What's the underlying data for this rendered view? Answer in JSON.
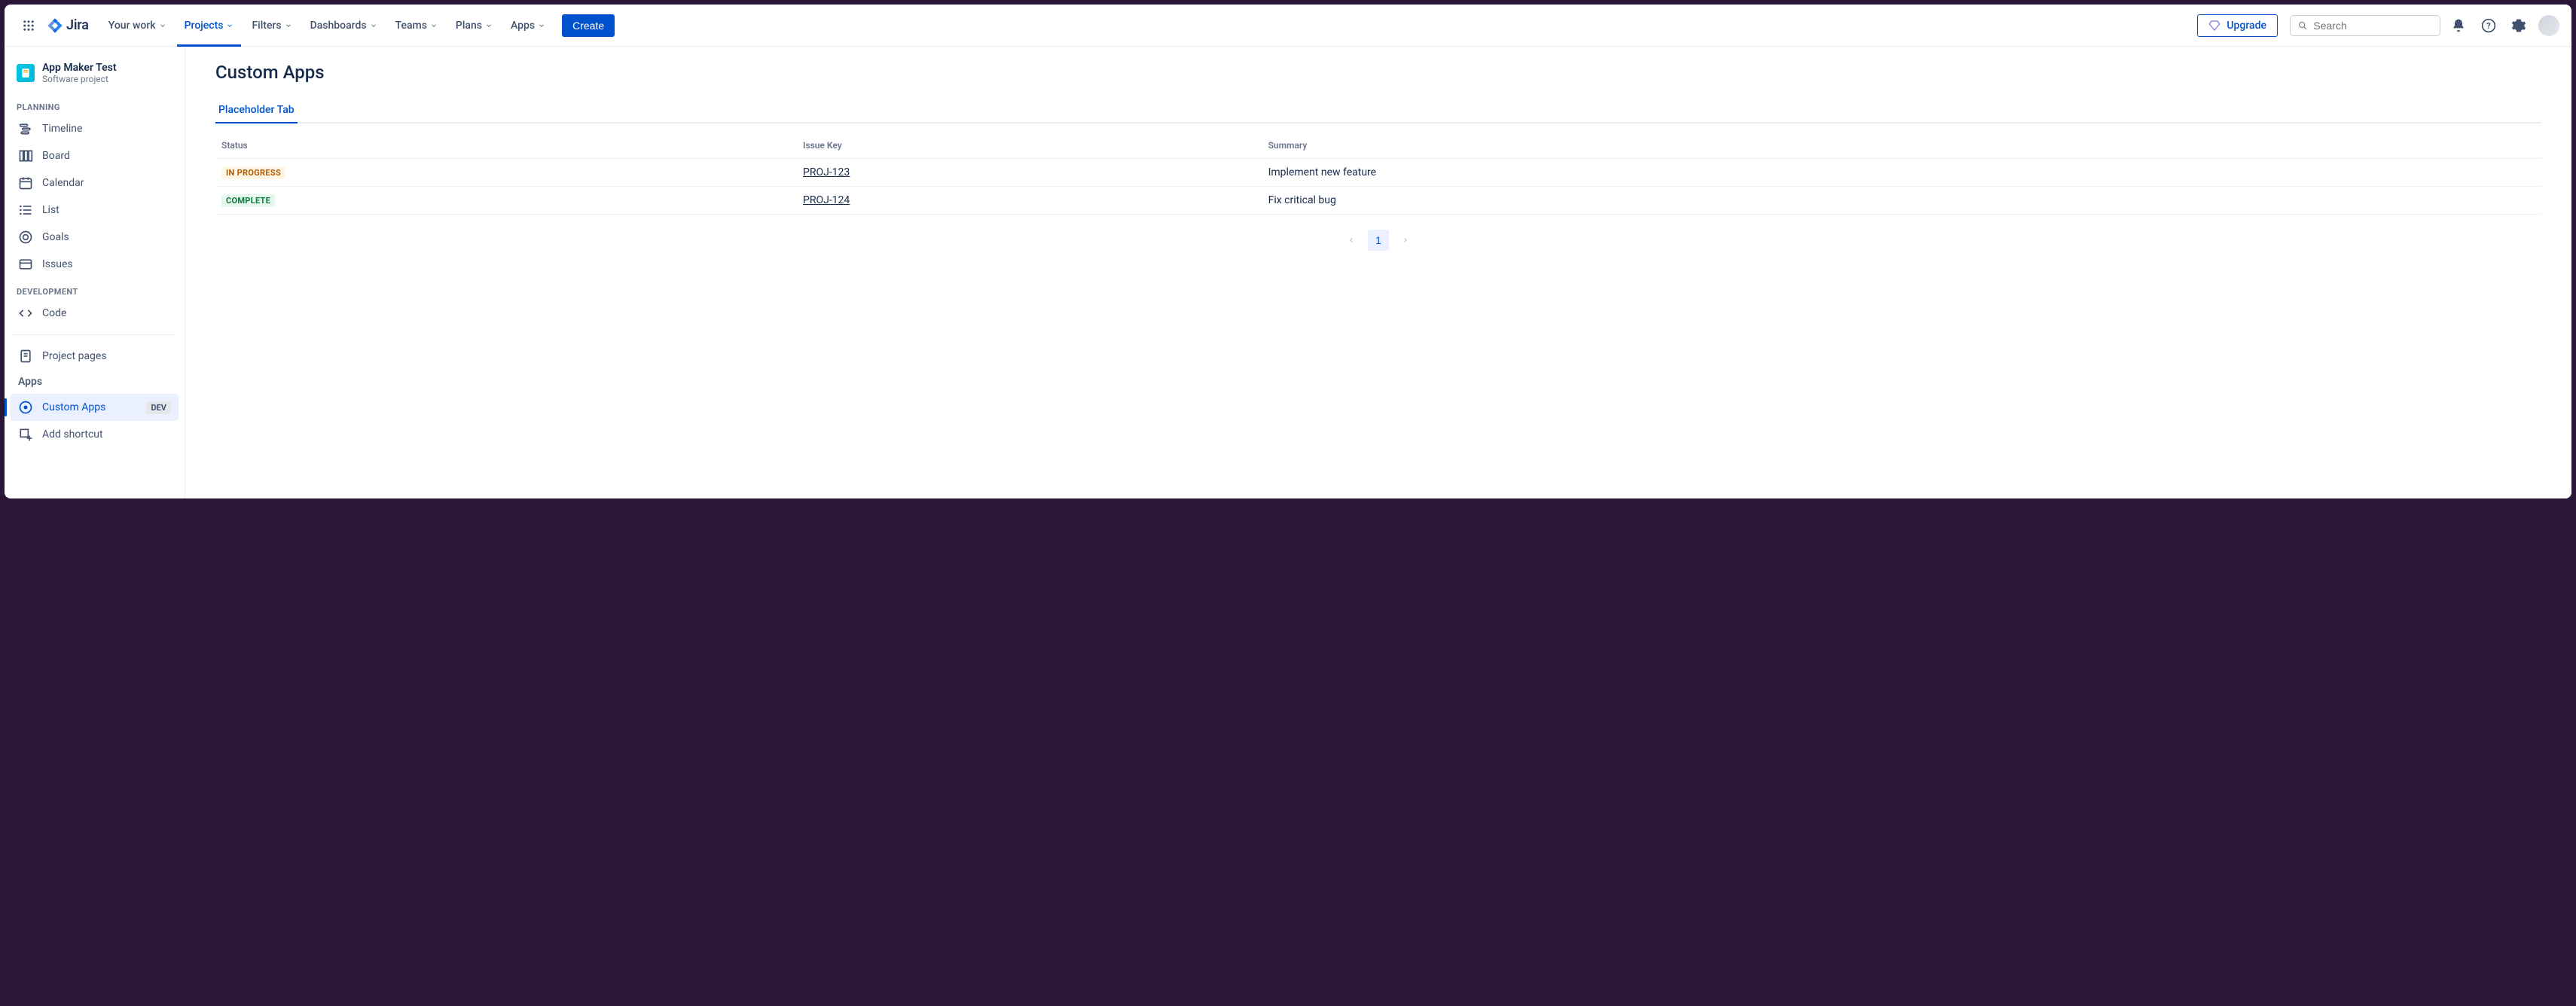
{
  "topnav": {
    "product_name": "Jira",
    "items": [
      {
        "label": "Your work",
        "active": false
      },
      {
        "label": "Projects",
        "active": true
      },
      {
        "label": "Filters",
        "active": false
      },
      {
        "label": "Dashboards",
        "active": false
      },
      {
        "label": "Teams",
        "active": false
      },
      {
        "label": "Plans",
        "active": false
      },
      {
        "label": "Apps",
        "active": false
      }
    ],
    "create_label": "Create",
    "upgrade_label": "Upgrade",
    "search_placeholder": "Search"
  },
  "sidebar": {
    "project": {
      "name": "App Maker Test",
      "type": "Software project"
    },
    "sections": {
      "planning_label": "PLANNING",
      "development_label": "DEVELOPMENT",
      "apps_label": "Apps"
    },
    "planning": [
      {
        "icon": "timeline-icon",
        "label": "Timeline"
      },
      {
        "icon": "board-icon",
        "label": "Board"
      },
      {
        "icon": "calendar-icon",
        "label": "Calendar"
      },
      {
        "icon": "list-icon",
        "label": "List"
      },
      {
        "icon": "goals-icon",
        "label": "Goals"
      },
      {
        "icon": "issues-icon",
        "label": "Issues"
      }
    ],
    "development": [
      {
        "icon": "code-icon",
        "label": "Code"
      }
    ],
    "pages": [
      {
        "icon": "page-icon",
        "label": "Project pages"
      }
    ],
    "apps": [
      {
        "icon": "app-icon",
        "label": "Custom Apps",
        "badge": "DEV",
        "selected": true
      }
    ],
    "add_shortcut_label": "Add shortcut"
  },
  "main": {
    "title": "Custom Apps",
    "tabs": [
      {
        "label": "Placeholder Tab",
        "active": true
      }
    ],
    "columns": [
      "Status",
      "Issue Key",
      "Summary"
    ],
    "rows": [
      {
        "status_label": "IN PROGRESS",
        "status_kind": "inprogress",
        "key": "PROJ-123",
        "summary": "Implement new feature"
      },
      {
        "status_label": "COMPLETE",
        "status_kind": "complete",
        "key": "PROJ-124",
        "summary": "Fix critical bug"
      }
    ],
    "pager_current": "1"
  }
}
